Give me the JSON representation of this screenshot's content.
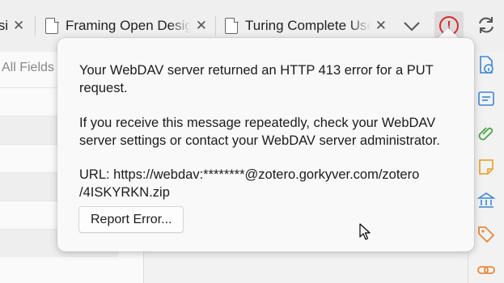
{
  "tabs": [
    {
      "label": "Desi",
      "close": "✕"
    },
    {
      "label": "Framing Open Design",
      "close": "✕"
    },
    {
      "label": "Turing Complete User",
      "close": "✕"
    }
  ],
  "toolbar": {
    "alert_icon": "exclamation-circle-icon",
    "sync_icon": "sync-icon",
    "overflow_icon": "chevron-down-icon",
    "alert_color": "#d92a2a",
    "alert_glyph": "!"
  },
  "left_pane": {
    "search_placeholder": "All Fields"
  },
  "right_sidebar": {
    "icons": [
      "info-icon",
      "abstract-icon",
      "attachments-icon",
      "notes-icon",
      "libraries-collections-icon",
      "tags-icon",
      "related-icon"
    ],
    "accent": "#3d86d6",
    "notes_color": "#e6a83a",
    "tags_color": "#e48a3c"
  },
  "popup": {
    "message_1": "Your WebDAV server returned an HTTP 413 error for a PUT request.",
    "message_2": "If you receive this message repeatedly, check your WebDAV server settings or contact your WebDAV server administrator.",
    "url_line_1": "URL: https://webdav:********@zotero.gorkyver.com/zotero",
    "url_line_2": "/4ISKYRKN.zip",
    "report_button": "Report Error..."
  }
}
